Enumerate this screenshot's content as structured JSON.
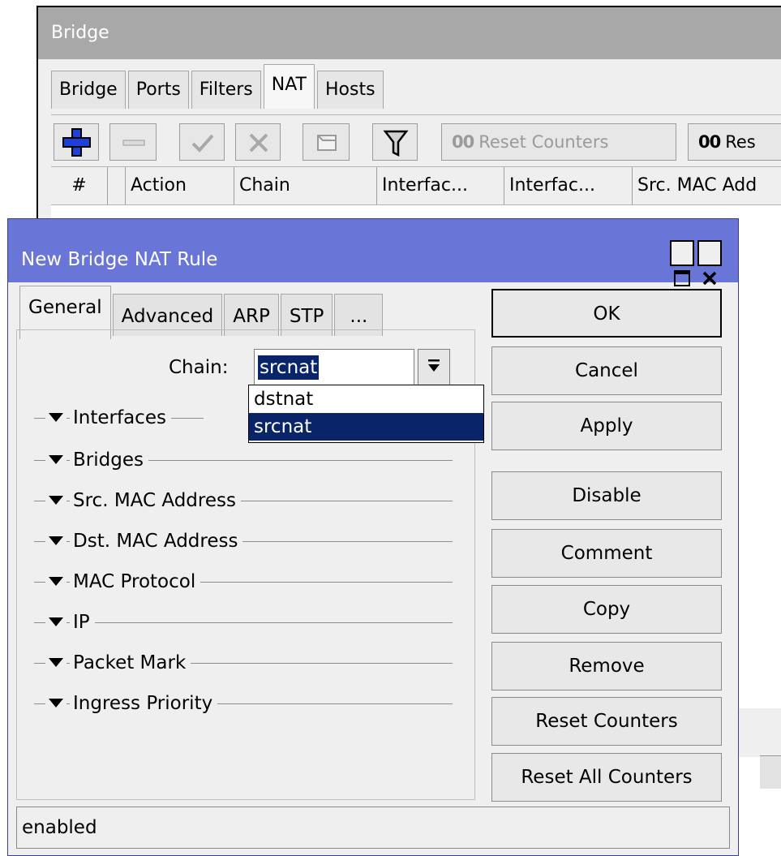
{
  "bridge": {
    "title": "Bridge",
    "tabs": [
      "Bridge",
      "Ports",
      "Filters",
      "NAT",
      "Hosts"
    ],
    "active_tab": "NAT",
    "toolbar": {
      "reset_counters": "Reset Counters",
      "reset_all_partial": "Res",
      "counter_glyph": "00"
    },
    "columns": [
      "#",
      "",
      "Action",
      "Chain",
      "Interfac...",
      "Interfac...",
      "Src. MAC Add"
    ]
  },
  "dialog": {
    "title": "New Bridge NAT Rule",
    "tabs": [
      "General",
      "Advanced",
      "ARP",
      "STP",
      "..."
    ],
    "active_tab": "General",
    "chain_label": "Chain:",
    "chain_value": "srcnat",
    "chain_options": [
      "dstnat",
      "srcnat"
    ],
    "selected_option": "srcnat",
    "sections": [
      "Interfaces",
      "Bridges",
      "Src. MAC Address",
      "Dst. MAC Address",
      "MAC Protocol",
      "IP",
      "Packet Mark",
      "Ingress Priority"
    ],
    "buttons": {
      "ok": "OK",
      "cancel": "Cancel",
      "apply": "Apply",
      "disable": "Disable",
      "comment": "Comment",
      "copy": "Copy",
      "remove": "Remove",
      "reset_counters": "Reset Counters",
      "reset_all_counters": "Reset All Counters"
    },
    "status": "enabled"
  },
  "colors": {
    "dialog_title_bar": "#6a75d8",
    "selection": "#0a246a",
    "add_icon": "#1e3fd8"
  }
}
